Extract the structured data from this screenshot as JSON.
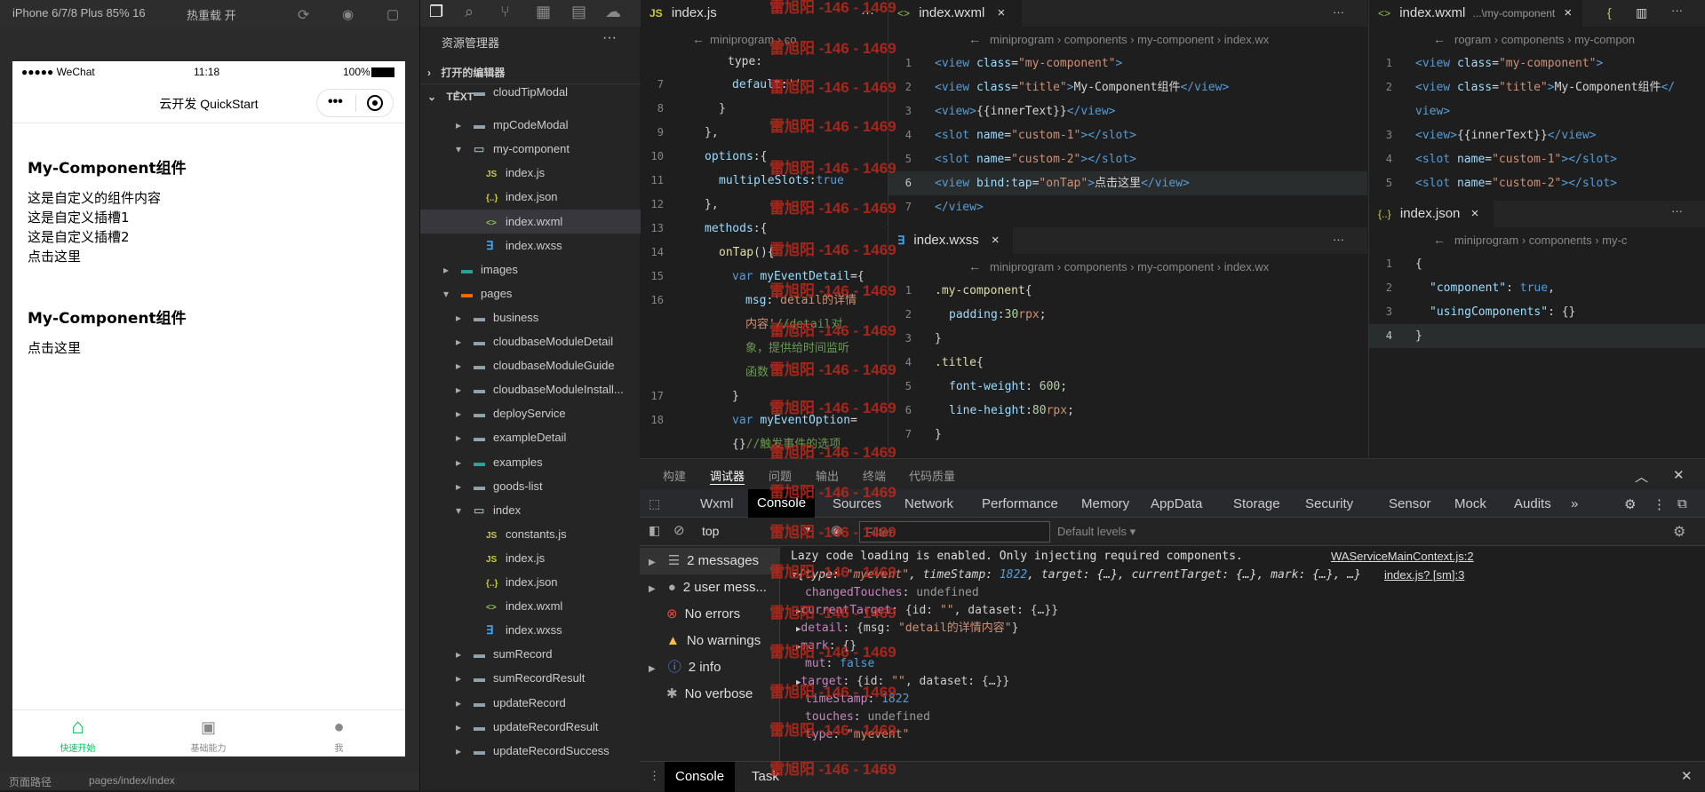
{
  "simulator": {
    "device": "iPhone 6/7/8 Plus 85% 16",
    "hot_reload": "热重载 开",
    "status_carrier": "●●●●● WeChat",
    "status_time": "11:18",
    "status_battery": "100%",
    "nav_title": "云开发 QuickStart",
    "comp1": {
      "title": "My-Component组件",
      "lines": [
        "这是自定义的组件内容",
        "这是自定义插槽1",
        "这是自定义插槽2",
        "点击这里"
      ]
    },
    "comp2": {
      "title": "My-Component组件",
      "lines": [
        "点击这里"
      ]
    },
    "tabs": [
      "快速开始",
      "基础能力",
      "我"
    ],
    "footer_path": "页面路径",
    "footer_page": "pages/index/index"
  },
  "explorer": {
    "title": "资源管理器",
    "open_editors": "打开的编辑器",
    "root": "TEXT",
    "items": [
      {
        "label": "cloudTipModal",
        "level": 2,
        "kind": "folder"
      },
      {
        "label": "mpCodeModal",
        "level": 2,
        "kind": "folder"
      },
      {
        "label": "my-component",
        "level": 2,
        "kind": "folder-open"
      },
      {
        "label": "index.js",
        "level": 3,
        "kind": "js"
      },
      {
        "label": "index.json",
        "level": 3,
        "kind": "json"
      },
      {
        "label": "index.wxml",
        "level": 3,
        "kind": "wxml",
        "selected": true
      },
      {
        "label": "index.wxss",
        "level": 3,
        "kind": "wxss"
      },
      {
        "label": "images",
        "level": 1,
        "kind": "folder-img"
      },
      {
        "label": "pages",
        "level": 1,
        "kind": "folder-pages"
      },
      {
        "label": "business",
        "level": 2,
        "kind": "folder"
      },
      {
        "label": "cloudbaseModuleDetail",
        "level": 2,
        "kind": "folder"
      },
      {
        "label": "cloudbaseModuleGuide",
        "level": 2,
        "kind": "folder"
      },
      {
        "label": "cloudbaseModuleInstall...",
        "level": 2,
        "kind": "folder"
      },
      {
        "label": "deployService",
        "level": 2,
        "kind": "folder"
      },
      {
        "label": "exampleDetail",
        "level": 2,
        "kind": "folder"
      },
      {
        "label": "examples",
        "level": 2,
        "kind": "folder-ex"
      },
      {
        "label": "goods-list",
        "level": 2,
        "kind": "folder"
      },
      {
        "label": "index",
        "level": 2,
        "kind": "folder-open"
      },
      {
        "label": "constants.js",
        "level": 3,
        "kind": "js"
      },
      {
        "label": "index.js",
        "level": 3,
        "kind": "js"
      },
      {
        "label": "index.json",
        "level": 3,
        "kind": "json"
      },
      {
        "label": "index.wxml",
        "level": 3,
        "kind": "wxml"
      },
      {
        "label": "index.wxss",
        "level": 3,
        "kind": "wxss"
      },
      {
        "label": "sumRecord",
        "level": 2,
        "kind": "folder"
      },
      {
        "label": "sumRecordResult",
        "level": 2,
        "kind": "folder"
      },
      {
        "label": "updateRecord",
        "level": 2,
        "kind": "folder"
      },
      {
        "label": "updateRecordResult",
        "level": 2,
        "kind": "folder"
      },
      {
        "label": "updateRecordSuccess",
        "level": 2,
        "kind": "folder"
      }
    ]
  },
  "editors": {
    "js_tab": "index.js",
    "js_crumb": "miniprogram › co",
    "wxml_tab": "index.wxml",
    "wxml_crumb": "miniprogram › components › my-component › index.wx",
    "wxml2_tab": "index.wxml",
    "wxml2_hint": "...\\my-component",
    "wxml2_crumb": "rogram › components › my-compon",
    "wxss_tab": "index.wxss",
    "wxss_crumb": "miniprogram › components › my-component › index.wx",
    "json_tab": "index.json",
    "json_crumb": "miniprogram › components › my-c"
  },
  "watermark": "雷旭阳 -146 - 1469",
  "panel": {
    "tabs": [
      "构建",
      "调试器",
      "问题",
      "输出",
      "终端",
      "代码质量"
    ],
    "devtools_tabs": [
      "Wxml",
      "Console",
      "Sources",
      "Network",
      "Performance",
      "Memory",
      "AppData",
      "Storage",
      "Security",
      "Sensor",
      "Mock",
      "Audits"
    ],
    "context": "top",
    "filter_placeholder": "Filter",
    "levels": "Default levels",
    "sidebar": [
      "2 messages",
      "2 user mess...",
      "No errors",
      "No warnings",
      "2 info",
      "No verbose"
    ],
    "log1": "Lazy code loading is enabled. Only injecting required components.",
    "log1_src": "WAServiceMainContext.js:2",
    "log2_src": "index.js? [sm]:3",
    "bottom_tabs": [
      "Console",
      "Task"
    ]
  },
  "colors": {
    "accent": "#07c160",
    "watermark": "#c0281b",
    "tab_active": "#094771"
  }
}
